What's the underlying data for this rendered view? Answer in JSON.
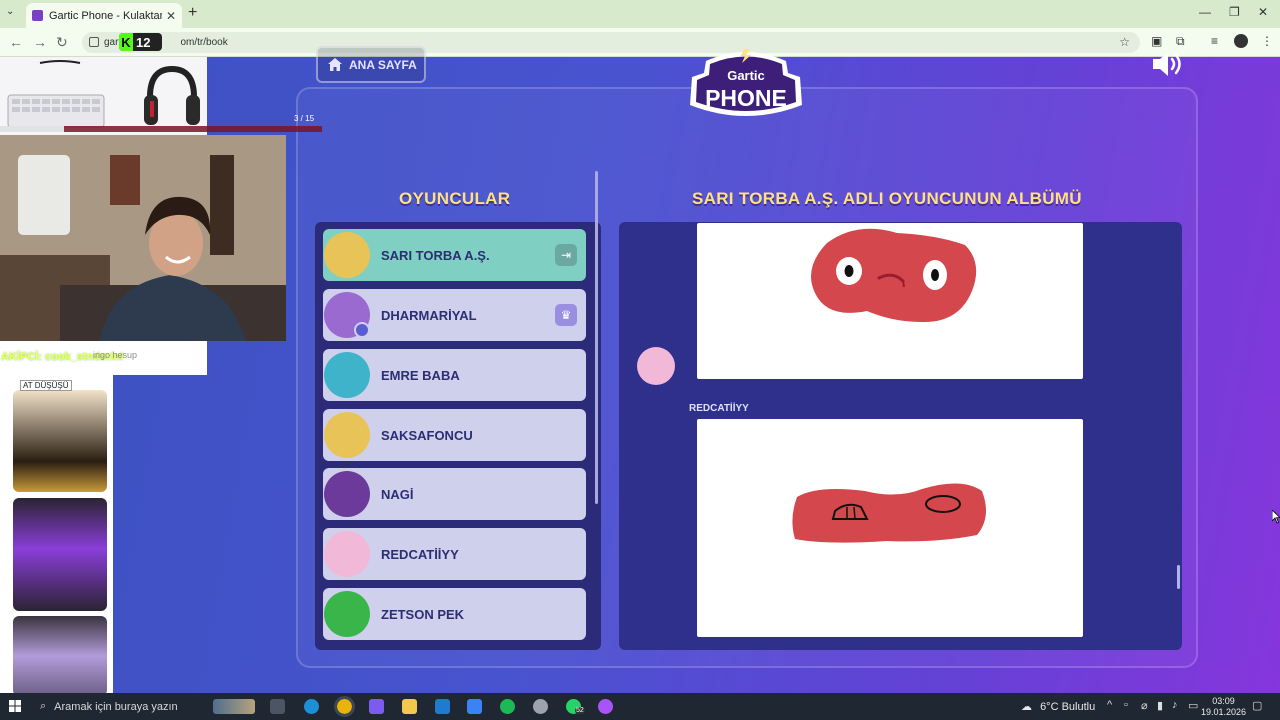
{
  "browser": {
    "tab_title": "Gartic Phone - Kulaktan Kulağa",
    "url_visible_start": "gartic",
    "url_visible_end": "om/tr/book",
    "new_tab_symbol": "+",
    "tab_close_symbol": "✕"
  },
  "kick_overlay": {
    "icon_letter": "K",
    "viewer_count": "12"
  },
  "game": {
    "home_button_label": "ANA SAYFA",
    "logo_top": "Gartic",
    "logo_bottom": "PHONE",
    "players_title": "OYUNCULAR",
    "album_title": "SARI TORBA A.Ş. ADLI OYUNCUNUN ALBÜMÜ",
    "players": [
      {
        "name": "SARI TORBA A.Ş.",
        "avatar_color": "#e8c458",
        "row_icon": "exit-icon",
        "active": true
      },
      {
        "name": "DHARMARİYAL",
        "avatar_color": "#9a6ad0",
        "row_icon": "crown-icon",
        "active": false,
        "host": true
      },
      {
        "name": "EMRE BABA",
        "avatar_color": "#3fb3c9",
        "active": false
      },
      {
        "name": "SAKSAFONCU",
        "avatar_color": "#e8c458",
        "active": false
      },
      {
        "name": "NAGİ",
        "avatar_color": "#6b3a9a",
        "active": false
      },
      {
        "name": "REDCATİİYY",
        "avatar_color": "#f2b8d8",
        "active": false
      },
      {
        "name": "ZETSON PEK",
        "avatar_color": "#39b54a",
        "active": false
      }
    ],
    "album_entries": [
      {
        "drawer": "REDCATİİYY"
      }
    ]
  },
  "stream_overlay": {
    "progress_text": "3 / 15",
    "progress_fraction": 0.2,
    "chat_line": "AKİPCİ: cook_stnderini",
    "side_text": "ingo hesup",
    "ad_label": "AT DÜŞÜŞÜ"
  },
  "taskbar": {
    "search_placeholder": "Aramak için buraya yazın",
    "weather": "6°C  Bulutlu",
    "time": "03:09",
    "date": "19.01.2026",
    "whatsapp_badge": "52"
  },
  "colors": {
    "accent_title": "#ffe083",
    "active_row": "#7fcfc2",
    "player_row": "#cfd0ec",
    "panel_bg": "#2b2b7a",
    "drawing_red": "#d4474c"
  }
}
